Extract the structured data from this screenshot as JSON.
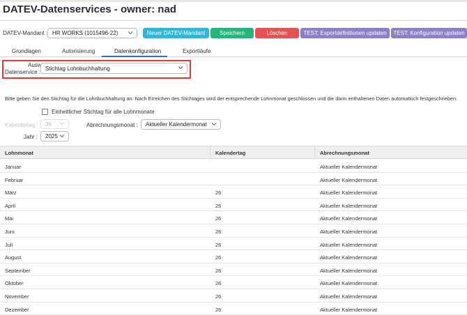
{
  "page": {
    "title": "DATEV-Datenservices - owner: nad"
  },
  "mandant": {
    "label": "DATEV-Mandant :",
    "selected": "HR WORKS (1015496-22)"
  },
  "toolbar": {
    "new_label": "Neuer DATEV-Mandant",
    "save_label": "Speichern",
    "delete_label": "Löschen",
    "test_export_label": "TEST: Exportdefinitionen updaten",
    "test_config_label": "TEST: Konfiguration updaten",
    "colors": {
      "new": "#33b5d6",
      "save": "#26b47a",
      "delete": "#e25353",
      "test": "#8a81c9"
    }
  },
  "tabs": [
    {
      "label": "Grundlagen"
    },
    {
      "label": "Autorisierung"
    },
    {
      "label": "Datenkonfiguration",
      "active": true
    },
    {
      "label": "Exportläufe"
    }
  ],
  "datenservice": {
    "label_line1": "Auswahl",
    "label_line2": "Datenservice :",
    "selected": "Stichtag Lohnbuchhaltung"
  },
  "info_text": "Bitte geben Sie den Stichtag für die Lohnbuchhaltung an. Nach Erreichen des Stichtages wird der entsprechende Lohnmonat geschlossen und die darin enthaltenen Daten automatisch festgeschrieben.",
  "options": {
    "uniform_label": "Einheitlicher Stichtag für alle Lohnmonate",
    "uniform_checked": false,
    "kalendertag_label": "Kalendertag :",
    "kalendertag_value": "26",
    "abrechnungsmonat_label": "Abrechnungsmonat :",
    "abrechnungsmonat_value": "Aktueller Kalendermonat",
    "jahr_label": "Jahr :",
    "jahr_value": "2025"
  },
  "table": {
    "headers": [
      "Lohnmonat",
      "Kalendertag",
      "Abrechnungsmonat"
    ],
    "rows": [
      [
        "Januar",
        "",
        "Aktueller Kalendermonat"
      ],
      [
        "Februar",
        "",
        "Aktueller Kalendermonat"
      ],
      [
        "März",
        "26",
        "Aktueller Kalendermonat"
      ],
      [
        "April",
        "26",
        "Aktueller Kalendermonat"
      ],
      [
        "Mai",
        "26",
        "Aktueller Kalendermonat"
      ],
      [
        "Juni",
        "26",
        "Aktueller Kalendermonat"
      ],
      [
        "Juli",
        "26",
        "Aktueller Kalendermonat"
      ],
      [
        "August",
        "26",
        "Aktueller Kalendermonat"
      ],
      [
        "September",
        "26",
        "Aktueller Kalendermonat"
      ],
      [
        "Oktober",
        "26",
        "Aktueller Kalendermonat"
      ],
      [
        "November",
        "26",
        "Aktueller Kalendermonat"
      ],
      [
        "Dezember",
        "26",
        "Aktueller Kalendermonat"
      ]
    ]
  }
}
